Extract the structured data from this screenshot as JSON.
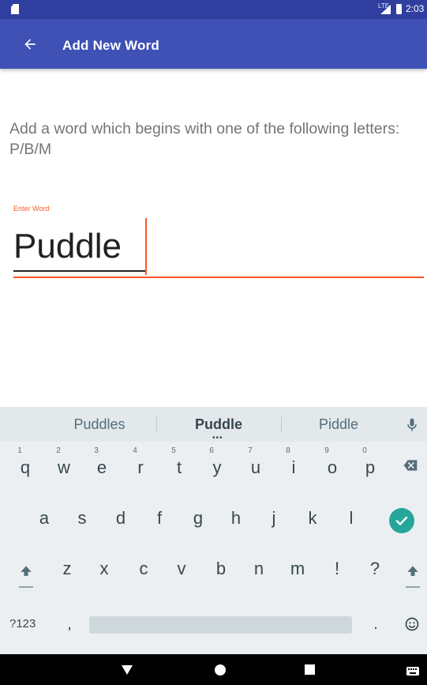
{
  "status_bar": {
    "time": "2:03",
    "network": "LTE",
    "icons": [
      "sd-card-icon",
      "signal-icon",
      "battery-icon"
    ]
  },
  "app_bar": {
    "title": "Add New Word",
    "back_icon": "arrow-back-icon",
    "color": "#3F51B5",
    "status_color": "#303F9F"
  },
  "content": {
    "instruction": "Add a word which begins with one of the following letters: P/B/M",
    "field_label": "Enter Word",
    "field_value": "Puddle",
    "accent_color": "#FF5722"
  },
  "keyboard": {
    "suggestions": [
      "Puddles",
      "Puddle",
      "Piddle"
    ],
    "row1": [
      {
        "key": "q",
        "hint": "1"
      },
      {
        "key": "w",
        "hint": "2"
      },
      {
        "key": "e",
        "hint": "3"
      },
      {
        "key": "r",
        "hint": "4"
      },
      {
        "key": "t",
        "hint": "5"
      },
      {
        "key": "y",
        "hint": "6"
      },
      {
        "key": "u",
        "hint": "7"
      },
      {
        "key": "i",
        "hint": "8"
      },
      {
        "key": "o",
        "hint": "9"
      },
      {
        "key": "p",
        "hint": "0"
      }
    ],
    "row2": [
      "a",
      "s",
      "d",
      "f",
      "g",
      "h",
      "j",
      "k",
      "l"
    ],
    "row3": [
      "z",
      "x",
      "c",
      "v",
      "b",
      "n",
      "m",
      "!",
      "?"
    ],
    "symbols_label": "?123",
    "comma": ",",
    "period": ".",
    "enter_color": "#26A69A",
    "icons": [
      "mic-icon",
      "backspace-icon",
      "enter-check-icon",
      "shift-icon",
      "emoji-icon"
    ]
  },
  "nav_bar": {
    "icons": [
      "nav-back-icon",
      "nav-home-icon",
      "nav-recents-icon",
      "nav-keyboard-icon"
    ]
  }
}
